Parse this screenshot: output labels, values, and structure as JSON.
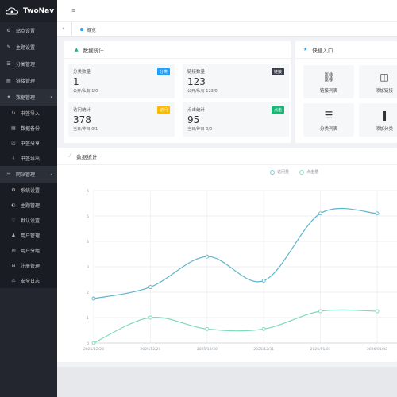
{
  "app": {
    "name": "TwoNav"
  },
  "sidebar": {
    "items": [
      {
        "icon": "⚙",
        "label": "站点设置"
      },
      {
        "icon": "✎",
        "label": "主题设置"
      },
      {
        "icon": "☰",
        "label": "分类管理"
      },
      {
        "icon": "▤",
        "label": "链接管理"
      }
    ],
    "group1": {
      "icon": "✦",
      "label": "数据管理",
      "arrow": "▾"
    },
    "group1_items": [
      {
        "icon": "↻",
        "label": "书签导入"
      },
      {
        "icon": "▤",
        "label": "数据备份"
      },
      {
        "icon": "☑",
        "label": "书签分享"
      },
      {
        "icon": "⇩",
        "label": "书签导出"
      }
    ],
    "group2": {
      "icon": "☰",
      "label": "网站管理",
      "arrow": "▴"
    },
    "group2_items": [
      {
        "icon": "⚙",
        "label": "系统设置"
      },
      {
        "icon": "◐",
        "label": "主题管理"
      },
      {
        "icon": "♡",
        "label": "默认设置"
      },
      {
        "icon": "♟",
        "label": "用户管理"
      },
      {
        "icon": "✉",
        "label": "用户分组"
      },
      {
        "icon": "⊟",
        "label": "注册管理"
      },
      {
        "icon": "⚠",
        "label": "安全日志"
      }
    ]
  },
  "topbar": {
    "menu_icon": "≡"
  },
  "tabbar": {
    "back": "‹",
    "tab_label": "概览"
  },
  "stats_card": {
    "title": "数据统计",
    "icon": "▲",
    "stats": [
      {
        "label": "分类数量",
        "value": "1",
        "sub": "公开/私有 1/0",
        "badge": "分类",
        "color": "#1e9fff"
      },
      {
        "label": "链接数量",
        "value": "123",
        "sub": "公开/私有 123/0",
        "badge": "链接",
        "color": "#393d49"
      },
      {
        "label": "访问统计",
        "value": "378",
        "sub": "当日/昨日 0/1",
        "badge": "访问",
        "color": "#ffb800"
      },
      {
        "label": "点击统计",
        "value": "95",
        "sub": "当日/昨日 0/0",
        "badge": "点击",
        "color": "#16b777"
      }
    ]
  },
  "quick_card": {
    "title": "快捷入口",
    "icon": "★",
    "items": [
      {
        "icon": "⛓",
        "label": "链接列表"
      },
      {
        "icon": "◫",
        "label": "添加链接"
      },
      {
        "icon": "☰",
        "label": "分类列表"
      },
      {
        "icon": "❚",
        "label": "添加分类"
      }
    ]
  },
  "chart_card": {
    "title": "数据统计",
    "icon": "📈",
    "legend": [
      {
        "name": "访问量",
        "color": "#80c8da"
      },
      {
        "name": "点击量",
        "color": "#8fe0c4"
      }
    ]
  },
  "chart_data": {
    "type": "line",
    "x": [
      "2025/12/28",
      "2025/12/29",
      "2025/12/30",
      "2025/12/31",
      "2026/01/01",
      "2026/01/02"
    ],
    "y_ticks": [
      "0",
      "1",
      "2",
      "3",
      "4",
      "5",
      "6"
    ],
    "series": [
      {
        "name": "访问量",
        "color": "#5fb4cc",
        "values": [
          1.75,
          2.2,
          3.4,
          2.45,
          5.1,
          5.1
        ]
      },
      {
        "name": "点击量",
        "color": "#7fdab8",
        "values": [
          0,
          1.0,
          0.55,
          0.55,
          1.25,
          1.25
        ]
      }
    ],
    "ylim": [
      0,
      6
    ],
    "grid": true
  }
}
